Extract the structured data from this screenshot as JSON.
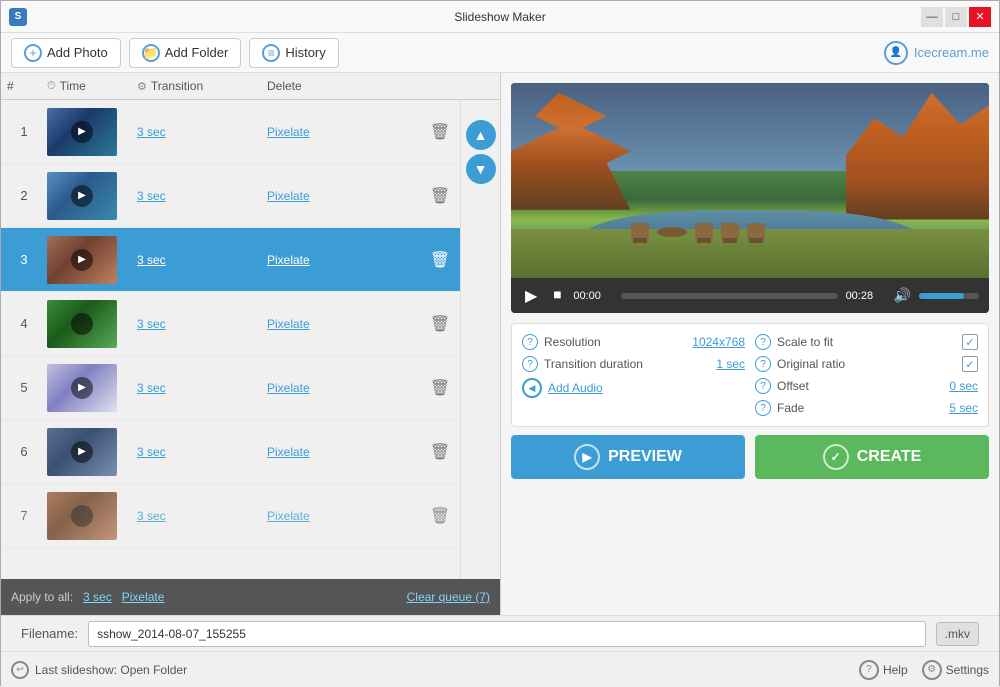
{
  "titleBar": {
    "title": "Slideshow Maker",
    "appIcon": "S",
    "controls": {
      "minimize": "—",
      "maximize": "□",
      "close": "✕"
    }
  },
  "toolbar": {
    "addPhoto": "Add Photo",
    "addFolder": "Add Folder",
    "history": "History",
    "brand": "Icecream.me"
  },
  "tableHeader": {
    "num": "#",
    "time": "Time",
    "transition": "Transition",
    "delete": "Delete"
  },
  "slides": [
    {
      "num": "1",
      "time": "3 sec",
      "transition": "Pixelate",
      "thumbClass": "thumb-1"
    },
    {
      "num": "2",
      "time": "3 sec",
      "transition": "Pixelate",
      "thumbClass": "thumb-2"
    },
    {
      "num": "3",
      "time": "3 sec",
      "transition": "Pixelate",
      "thumbClass": "thumb-3",
      "selected": true
    },
    {
      "num": "4",
      "time": "3 sec",
      "transition": "Pixelate",
      "thumbClass": "thumb-4"
    },
    {
      "num": "5",
      "time": "3 sec",
      "transition": "Pixelate",
      "thumbClass": "thumb-5"
    },
    {
      "num": "6",
      "time": "3 sec",
      "transition": "Pixelate",
      "thumbClass": "thumb-6"
    },
    {
      "num": "7",
      "time": "3 sec",
      "transition": "Pixelate",
      "thumbClass": "thumb-7"
    }
  ],
  "applyBar": {
    "label": "Apply to all:",
    "time": "3 sec",
    "transition": "Pixelate",
    "clearQueue": "Clear queue (7)"
  },
  "videoControls": {
    "timeStart": "00:00",
    "timeEnd": "00:28"
  },
  "settings": {
    "resolution": {
      "label": "Resolution",
      "value": "1024x768"
    },
    "transitionDuration": {
      "label": "Transition duration",
      "value": "1 sec"
    },
    "addAudio": "Add Audio",
    "scaleToFit": {
      "label": "Scale to fit",
      "checked": true
    },
    "originalRatio": {
      "label": "Original ratio",
      "checked": true
    },
    "offset": {
      "label": "Offset",
      "value": "0 sec"
    },
    "fade": {
      "label": "Fade",
      "value": "5 sec"
    }
  },
  "filenameBar": {
    "label": "Filename:",
    "value": "sshow_2014-08-07_155255",
    "ext": ".mkv"
  },
  "actionButtons": {
    "preview": "PREVIEW",
    "create": "CREATE"
  },
  "statusBar": {
    "lastSlideshow": "Last slideshow: Open Folder",
    "help": "Help",
    "settings": "Settings"
  }
}
